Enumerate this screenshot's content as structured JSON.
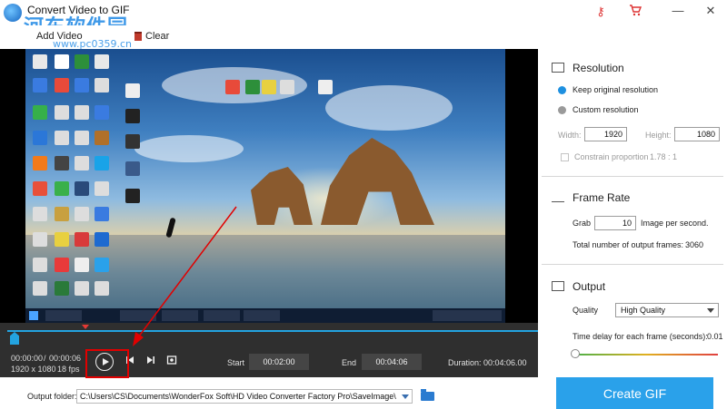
{
  "app": {
    "title": "Convert Video to GIF",
    "watermark": "河东软件园",
    "watermark_url": "www.pc0359.cn"
  },
  "titlebar": {
    "key_icon": "key-icon",
    "cart_icon": "cart-icon",
    "minimize": "—",
    "close": "✕"
  },
  "toolbar": {
    "add_video_label": "Add Video",
    "clear_label": "Clear"
  },
  "timeline": {
    "current_time": "00:00:00",
    "separator": "/",
    "total_time": "00:00:06",
    "resolution": "1920 x 1080",
    "fps": "18 fps",
    "start_label": "Start",
    "start_value": "00:02:00",
    "end_label": "End",
    "end_value": "00:04:06",
    "duration_label": "Duration:",
    "duration_value": "00:04:06.00",
    "prev_icon": "prev-frame-icon",
    "next_icon": "next-frame-icon",
    "snapshot_icon": "camera-icon"
  },
  "settings": {
    "resolution": {
      "title": "Resolution",
      "keep_label": "Keep original resolution",
      "custom_label": "Custom resolution",
      "width_label": "Width:",
      "width_value": "1920",
      "height_label": "Height:",
      "height_value": "1080",
      "constrain_label": "Constrain proportion",
      "ratio": "1.78 : 1",
      "selected": "keep"
    },
    "frame_rate": {
      "title": "Frame Rate",
      "grab_label": "Grab",
      "grab_value": "10",
      "grab_suffix": "Image per second.",
      "total_label": "Total number of output frames:",
      "total_value": "3060"
    },
    "output": {
      "title": "Output",
      "quality_label": "Quality",
      "quality_value": "High Quality",
      "delay_label": "Time delay for each frame (seconds):",
      "delay_value": "0.01"
    }
  },
  "bottom": {
    "output_folder_label": "Output folder:",
    "output_path": "C:\\Users\\CS\\Documents\\WonderFox Soft\\HD Video Converter Factory Pro\\SaveImage\\",
    "create_gif_label": "Create GIF"
  },
  "colors": {
    "accent": "#2aa1ea",
    "timeline_bg": "#2f2f2f",
    "annotation": "#e10000"
  }
}
